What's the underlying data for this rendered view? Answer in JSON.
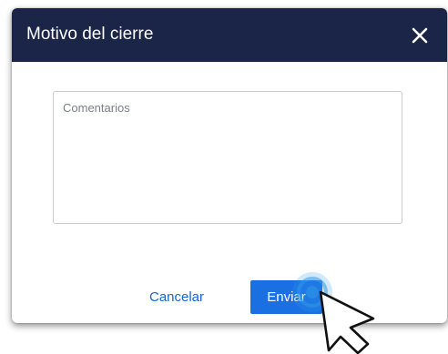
{
  "dialog": {
    "title": "Motivo del cierre",
    "close_icon": "close-icon"
  },
  "comments": {
    "placeholder": "Comentarios",
    "value": ""
  },
  "actions": {
    "cancel_label": "Cancelar",
    "send_label": "Enviar"
  },
  "colors": {
    "header_bg": "#1b2547",
    "primary": "#1a70e3",
    "link": "#1766d1",
    "ripple": "#2f9be8"
  },
  "cursor": {
    "icon": "mouse-pointer-icon",
    "state": "clicking"
  }
}
